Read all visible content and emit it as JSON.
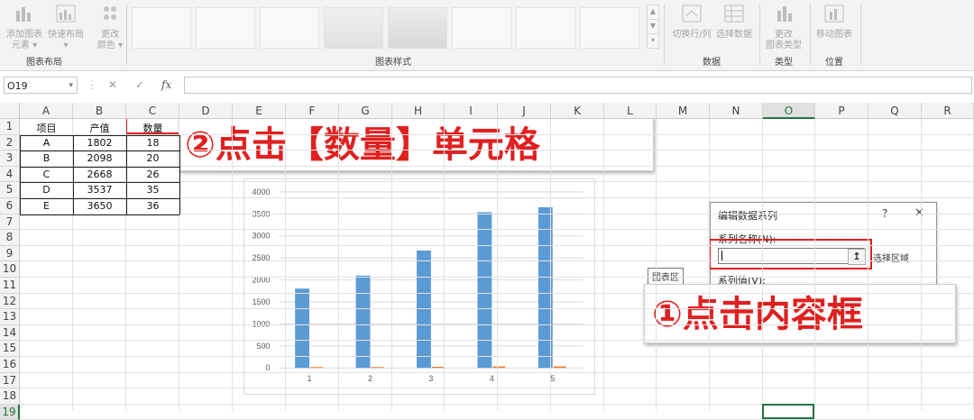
{
  "ribbon": {
    "add_element_label": "添加图表\n元素 ▾",
    "quick_layout_label": "快速布局\n▾",
    "change_color_label": "更改\n颜色 ▾",
    "group_chart_layout": "图表布局",
    "group_chart_styles": "图表样式",
    "switch_row_col_label": "切换行/列",
    "select_data_label": "选择数据",
    "group_data": "数据",
    "change_type_label": "更改\n图表类型",
    "group_type": "类型",
    "move_chart_label": "移动图表",
    "group_location": "位置"
  },
  "formula_bar": {
    "name_box": "O19",
    "cancel": "✕",
    "confirm": "✓",
    "fx": "fx",
    "value": ""
  },
  "columns": [
    "A",
    "B",
    "C",
    "D",
    "E",
    "F",
    "G",
    "H",
    "I",
    "J",
    "K",
    "L",
    "M",
    "N",
    "O",
    "P",
    "Q",
    "R"
  ],
  "selected_column": "O",
  "rows": [
    "1",
    "2",
    "3",
    "4",
    "5",
    "6",
    "7",
    "8",
    "9",
    "10",
    "11",
    "12",
    "13",
    "14",
    "15",
    "16",
    "17",
    "18",
    "19"
  ],
  "selected_row": "19",
  "table": {
    "headers": [
      "项目",
      "产值",
      "数量"
    ],
    "rows": [
      [
        "A",
        "1802",
        "18"
      ],
      [
        "B",
        "2098",
        "20"
      ],
      [
        "C",
        "2668",
        "26"
      ],
      [
        "D",
        "3537",
        "35"
      ],
      [
        "E",
        "3650",
        "36"
      ]
    ]
  },
  "chart_data": {
    "type": "bar",
    "categories": [
      "1",
      "2",
      "3",
      "4",
      "5"
    ],
    "series": [
      {
        "values": [
          1802,
          2098,
          2668,
          3537,
          3650
        ],
        "color": "#5b9bd5"
      },
      {
        "values": [
          18,
          20,
          26,
          35,
          36
        ],
        "color": "#ed7d31"
      }
    ],
    "yticks": [
      "0",
      "500",
      "1000",
      "1500",
      "2000",
      "2500",
      "3000",
      "3500",
      "4000"
    ],
    "ylim": [
      0,
      4000
    ],
    "grid": true,
    "title": "",
    "xlabel": "",
    "ylabel": ""
  },
  "dialog": {
    "title": "编辑数据系列",
    "help": "?",
    "close": "✕",
    "series_name_label": "系列名称(N):",
    "series_name_value": "",
    "select_range_label": "选择区域",
    "series_values_label": "系列值(V):",
    "collapse_icon": "↥"
  },
  "tooltip": "图表区",
  "annotations": {
    "step2": "②点击【数量】单元格",
    "step1": "①点击内容框"
  },
  "colors": {
    "accent_red": "#e02020",
    "excel_green": "#217346",
    "bar_blue": "#5b9bd5",
    "bar_orange": "#ed7d31"
  }
}
